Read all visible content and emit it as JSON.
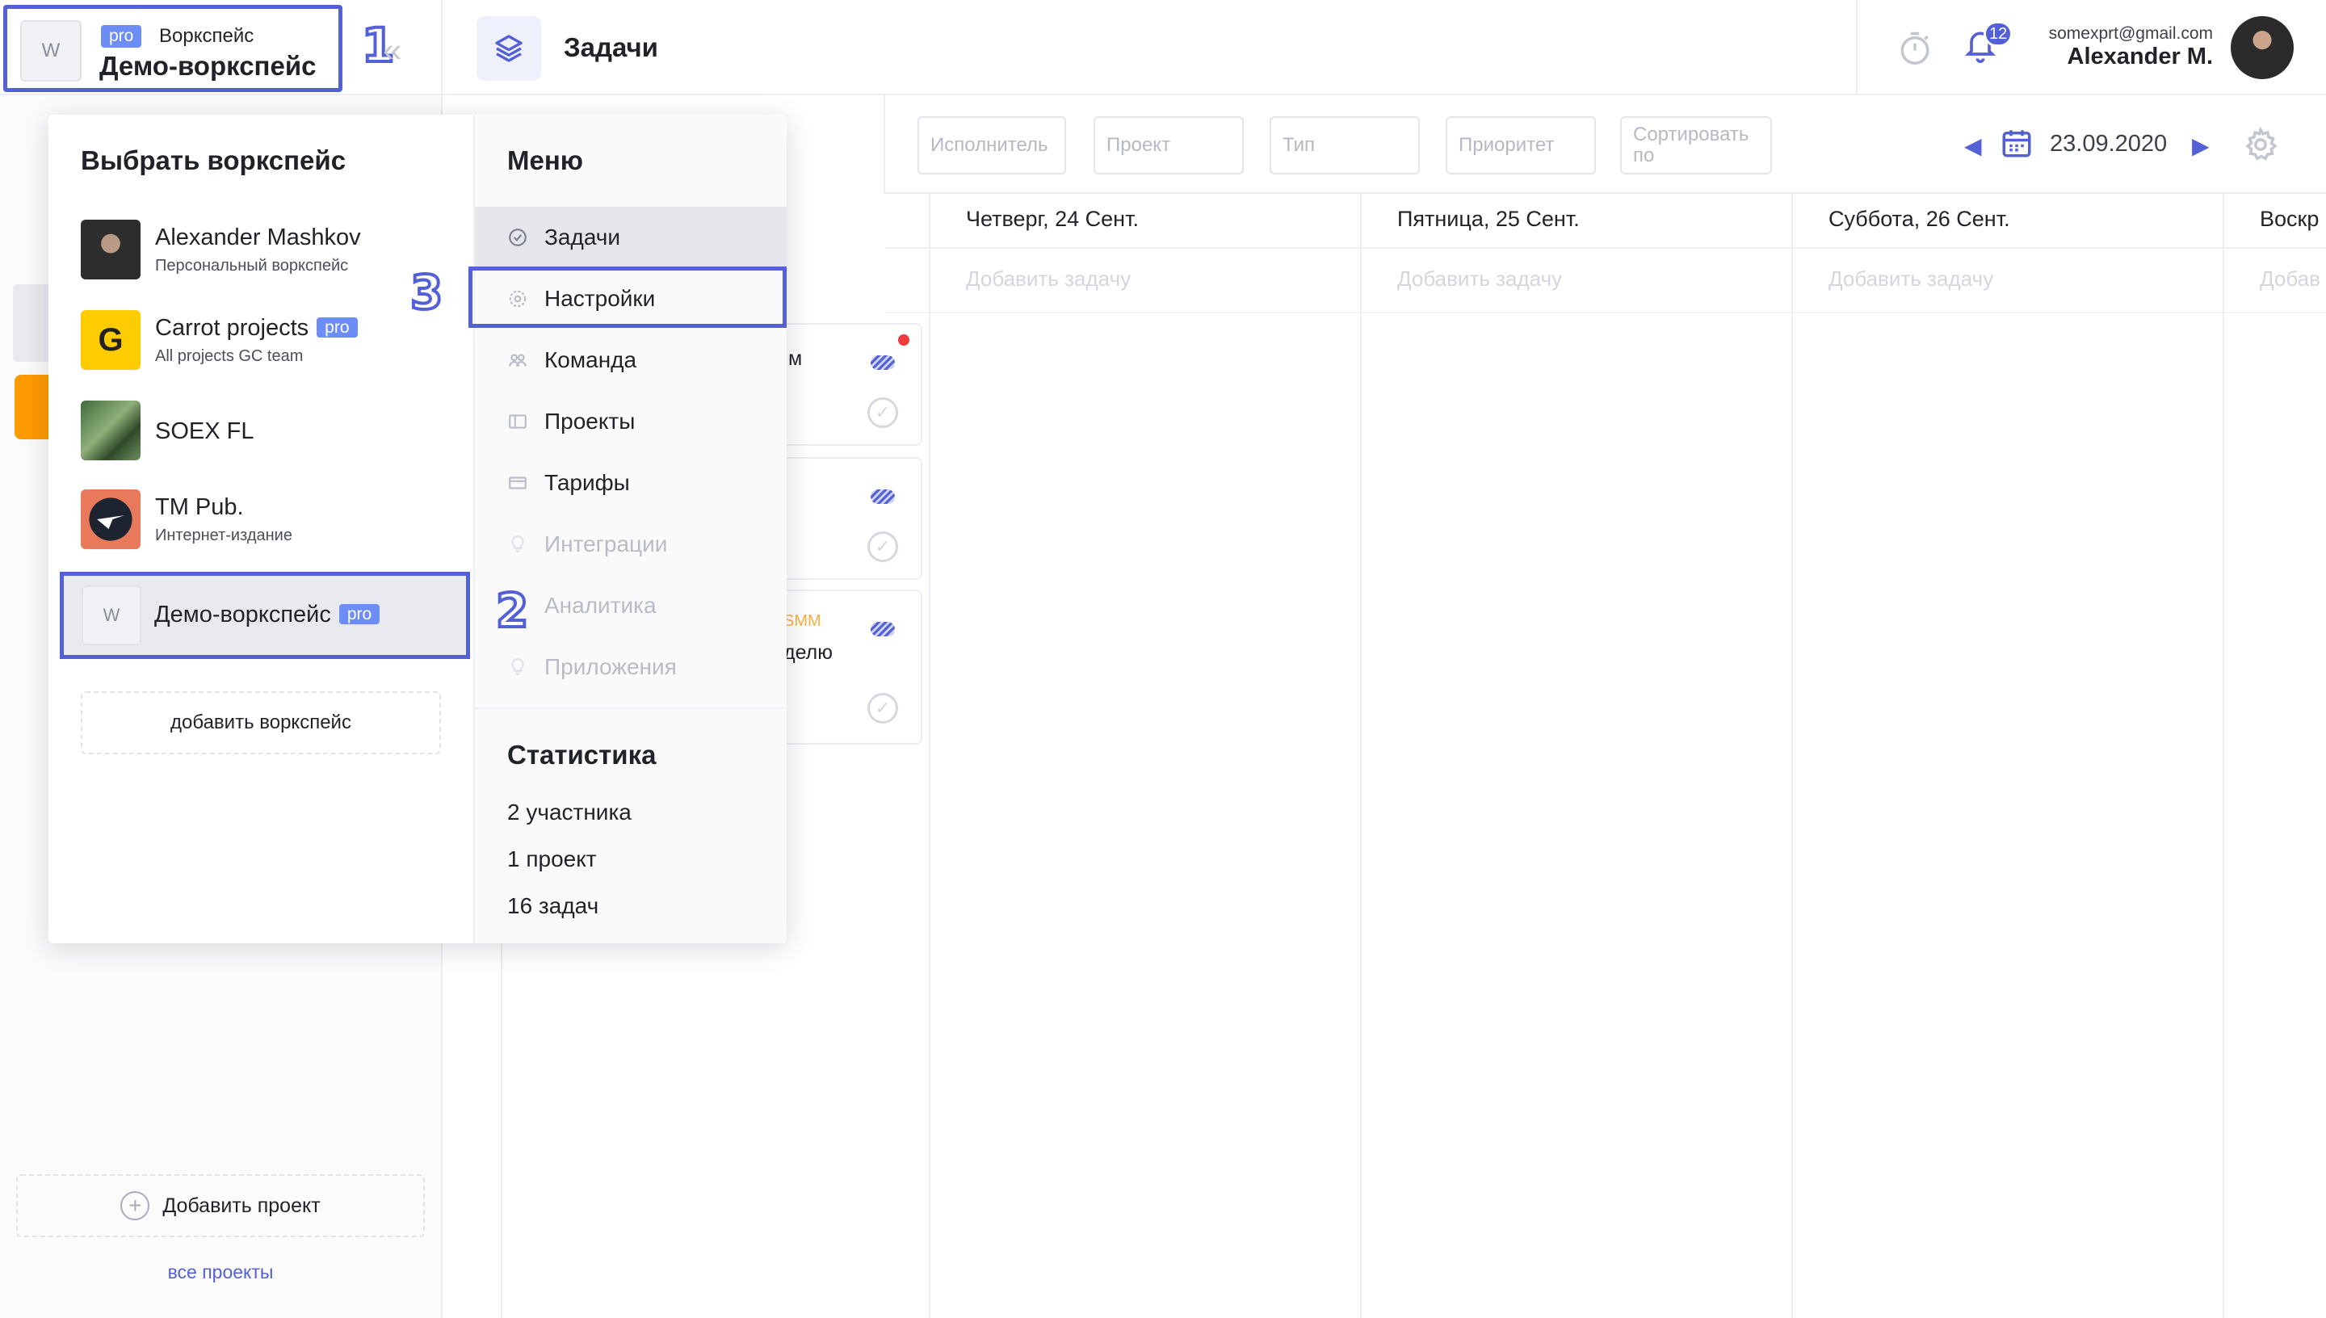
{
  "workspace_switcher": {
    "avatar_letter": "W",
    "badge": "pro",
    "kind_label": "Воркспейс",
    "name": "Демо-воркспейс"
  },
  "steps": [
    "1",
    "2",
    "3"
  ],
  "header": {
    "section_title": "Задачи",
    "notifications_count": "12",
    "user_email": "somexprt@gmail.com",
    "user_name": "Alexander M."
  },
  "filters": {
    "assignee": "Исполнитель",
    "project": "Проект",
    "type": "Тип",
    "priority": "Приоритет",
    "sort": "Сортировать по",
    "date": "23.09.2020"
  },
  "calendar": {
    "days": [
      "Четверг, 24 Сент.",
      "Пятница, 25 Сент.",
      "Суббота, 26 Сент.",
      "Воскр"
    ],
    "add_task": "Добавить задачу",
    "add_task_partial": "Добав",
    "card_fragments": [
      "м",
      "SMM",
      "делю"
    ]
  },
  "sidebar": {
    "add_project": "Добавить проект",
    "all_projects": "все проекты"
  },
  "dropdown": {
    "workspaces_title": "Выбрать воркспейс",
    "workspaces": [
      {
        "name": "Alexander Mashkov",
        "subtitle": "Персональный воркспейс",
        "pro": ""
      },
      {
        "name": "Carrot projects",
        "subtitle": "All projects GC team",
        "pro": "pro"
      },
      {
        "name": "SOEX FL",
        "subtitle": "",
        "pro": ""
      },
      {
        "name": "TM Pub.",
        "subtitle": "Интернет-издание",
        "pro": ""
      },
      {
        "name": "Демо-воркспейс",
        "subtitle": "",
        "pro": "pro",
        "avatar_letter": "W"
      }
    ],
    "add_workspace": "добавить воркспейс",
    "menu_title": "Меню",
    "menu": [
      "Задачи",
      "Настройки",
      "Команда",
      "Проекты",
      "Тарифы",
      "Интеграции",
      "Аналитика",
      "Приложения"
    ],
    "stats_title": "Статистика",
    "stats": [
      "2 участника",
      "1 проект",
      "16 задач"
    ]
  },
  "colors": {
    "accent": "#5360d6",
    "pro_badge": "#6c8df5",
    "orange": "#ff9b00"
  }
}
